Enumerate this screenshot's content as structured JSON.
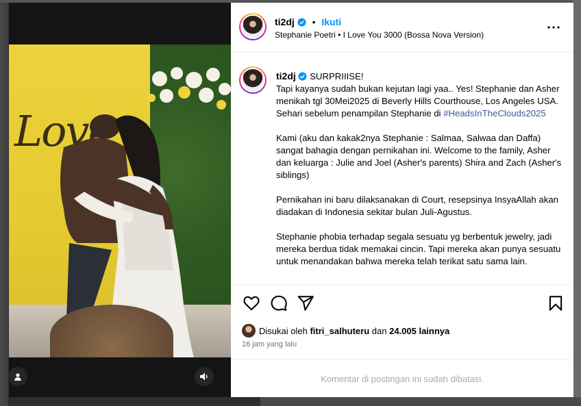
{
  "post": {
    "username": "ti2dj",
    "follow_label": "Ikuti",
    "audio": {
      "artist": "Stephanie Poetri",
      "separator": "•",
      "track": "I Love You 3000 (Bossa Nova Version)"
    },
    "more_icon": "more-horizontal-icon"
  },
  "media": {
    "wall_text": "Love",
    "user_tag_icon": "user-tag-icon",
    "sound_icon": "speaker-icon"
  },
  "caption": {
    "username": "ti2dj",
    "first_line": "SURPRIIISE!",
    "p1_text": "Tapi kayanya sudah bukan kejutan lagi yaa.. Yes! Stephanie dan Asher menikah tgl 30Mei2025 di Beverly Hills Courthouse, Los Angeles USA. Sehari sebelum penampilan Stephanie di ",
    "p1_hashtag": "#HeadsInTheClouds2025",
    "p2": "Kami (aku dan kakak2nya Stephanie : Salmaa, Salwaa dan Daffa) sangat bahagia dengan pernikahan ini. Welcome to the family, Asher dan keluarga : Julie and Joel (Asher's parents) Shira and Zach (Asher's siblings)",
    "p3": "Pernikahan ini baru dilaksanakan di Court, resepsinya InsyaAllah akan diadakan di Indonesia sekitar bulan Juli-Agustus.",
    "p4": "Stephanie phobia terhadap segala sesuatu yg berbentuk jewelry, jadi mereka berdua tidak memakai cincin. Tapi mereka akan punya sesuatu untuk menandakan bahwa mereka telah terikat satu sama lain."
  },
  "actions": {
    "like_icon": "heart-icon",
    "comment_icon": "comment-icon",
    "share_icon": "send-icon",
    "save_icon": "bookmark-icon"
  },
  "likes": {
    "prefix": "Disukai oleh",
    "liker": "fitri_salhuteru",
    "middle": "dan",
    "count": "24.005 lainnya"
  },
  "timestamp": "16 jam yang lalu",
  "comments_disabled": "Komentar di postingan ini sudah dibatasi.",
  "colors": {
    "link": "#0095f6",
    "hashtag": "#385898",
    "verified": "#0095f6"
  }
}
